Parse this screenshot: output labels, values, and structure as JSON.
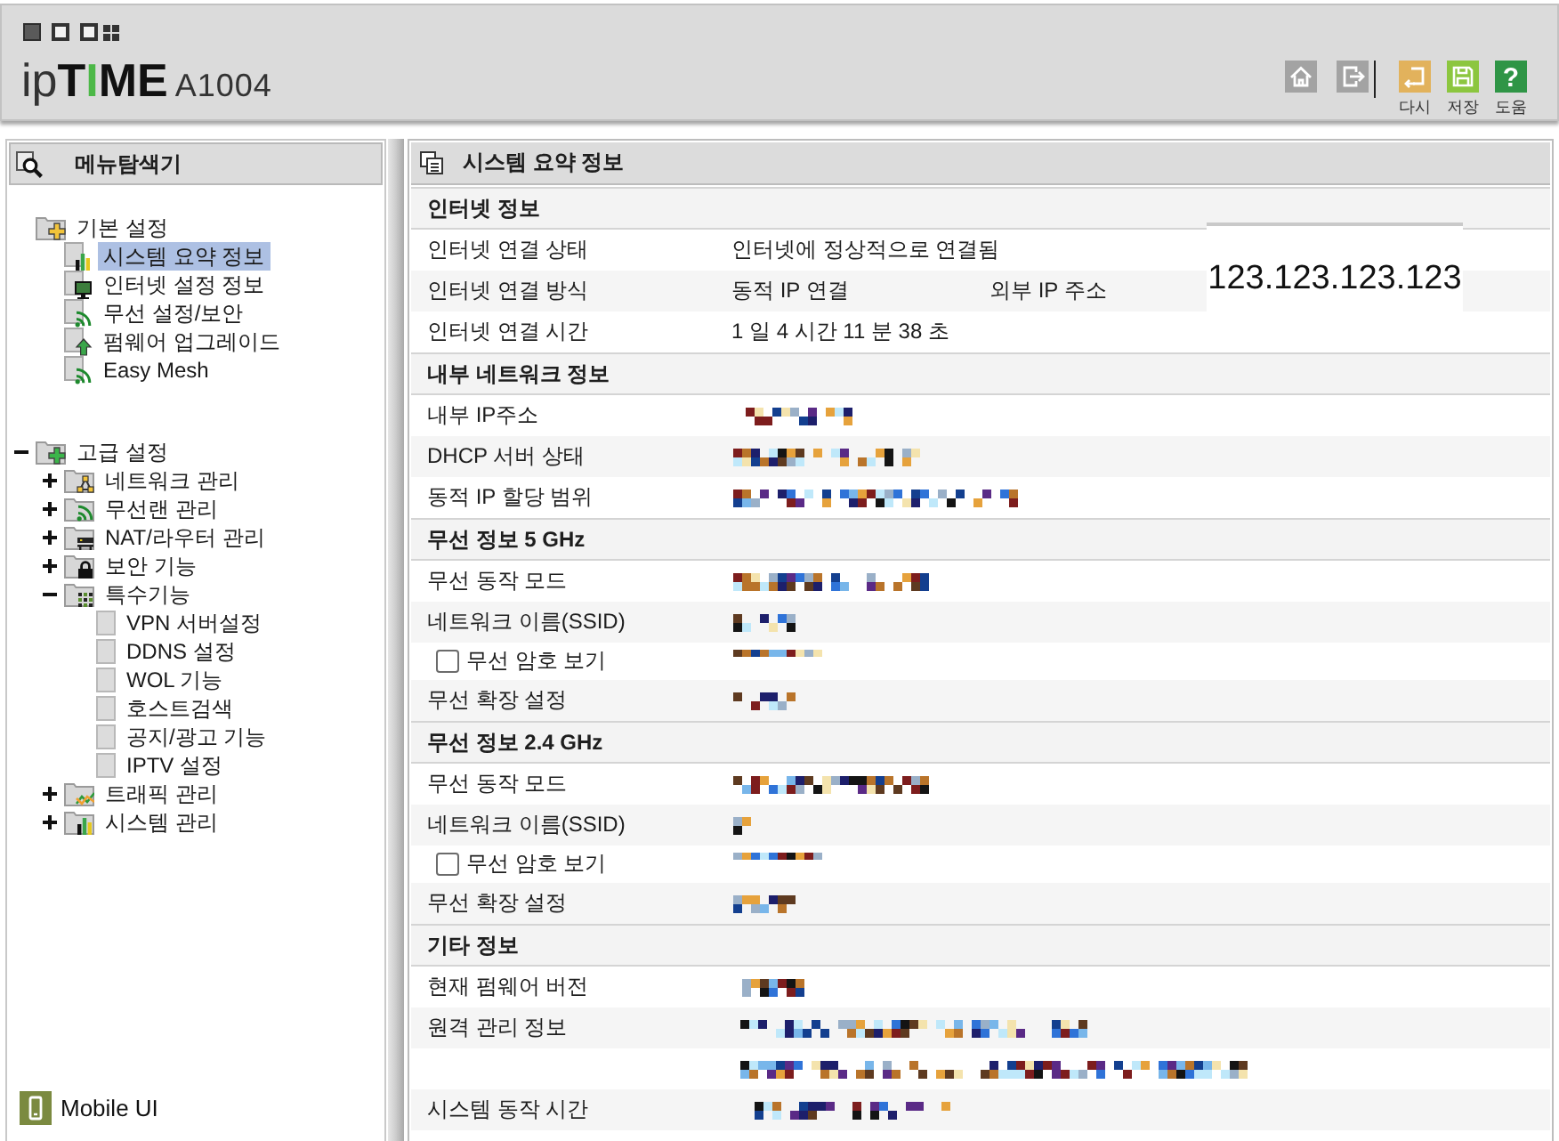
{
  "header": {
    "logo": {
      "segments": [
        {
          "text": "ip",
          "kind": "light"
        },
        {
          "text": "T",
          "kind": "bold"
        },
        {
          "text": "I",
          "kind": "accent"
        },
        {
          "text": "ME",
          "kind": "bold"
        }
      ],
      "model": "A1004"
    },
    "actions": [
      {
        "kind": "home"
      },
      {
        "kind": "logout"
      },
      {
        "kind": "retry",
        "label": "다시"
      },
      {
        "kind": "save",
        "label": "저장"
      },
      {
        "kind": "help",
        "label": "도움",
        "glyph": "?"
      }
    ]
  },
  "sidebar": {
    "title": "메뉴탐색기",
    "tree": [
      {
        "label": "기본 설정",
        "selected": false,
        "children": [
          {
            "label": "시스템 요약 정보",
            "selected": true
          },
          {
            "label": "인터넷 설정 정보",
            "selected": false
          },
          {
            "label": "무선 설정/보안",
            "selected": false
          },
          {
            "label": "펌웨어 업그레이드",
            "selected": false
          },
          {
            "label": "Easy Mesh",
            "selected": false
          }
        ]
      },
      {
        "label": "고급 설정",
        "selected": false,
        "expanded": true,
        "children": [
          {
            "label": "네트워크 관리",
            "selected": false,
            "expanded": false
          },
          {
            "label": "무선랜 관리",
            "selected": false,
            "expanded": false
          },
          {
            "label": "NAT/라우터 관리",
            "selected": false,
            "expanded": false
          },
          {
            "label": "보안 기능",
            "selected": false,
            "expanded": false
          },
          {
            "label": "특수기능",
            "selected": false,
            "expanded": true,
            "children": [
              {
                "label": "VPN 서버설정",
                "selected": false
              },
              {
                "label": "DDNS 설정",
                "selected": false
              },
              {
                "label": "WOL 기능",
                "selected": false
              },
              {
                "label": "호스트검색",
                "selected": false
              },
              {
                "label": "공지/광고 기능",
                "selected": false
              },
              {
                "label": "IPTV 설정",
                "selected": false
              }
            ]
          },
          {
            "label": "트래픽 관리",
            "selected": false,
            "expanded": false
          },
          {
            "label": "시스템 관리",
            "selected": false,
            "expanded": false
          }
        ]
      }
    ],
    "footer_link": "Mobile UI"
  },
  "main": {
    "title": "시스템 요약 정보",
    "sections": [
      {
        "title": "인터넷 정보",
        "rows": [
          {
            "kind": "text",
            "label": "인터넷 연결 상태",
            "value": "인터넷에 정상적으로 연결됨"
          },
          {
            "kind": "text",
            "label": "인터넷 연결 방식",
            "value": "동적 IP 연결",
            "extra_label": "외부 IP 주소",
            "extra_value": "123.123.123.123"
          },
          {
            "kind": "text",
            "label": "인터넷 연결 시간",
            "value": "1 일 4 시간 11 분 38 초"
          }
        ]
      },
      {
        "title": "내부 네트워크 정보",
        "rows": [
          {
            "kind": "text",
            "label": "내부 IP주소",
            "masked": true
          },
          {
            "kind": "text",
            "label": "DHCP 서버 상태",
            "masked": true
          },
          {
            "kind": "text",
            "label": "동적 IP 할당 범위",
            "masked": true
          }
        ]
      },
      {
        "title": "무선 정보 5 GHz",
        "rows": [
          {
            "kind": "text",
            "label": "무선 동작 모드",
            "masked": true
          },
          {
            "kind": "text",
            "label": "네트워크 이름(SSID)",
            "masked": true
          },
          {
            "kind": "checkbox",
            "label": "무선 암호 보기",
            "checked": false,
            "masked": true
          },
          {
            "kind": "text",
            "label": "무선 확장 설정",
            "masked": true
          }
        ]
      },
      {
        "title": "무선 정보 2.4 GHz",
        "rows": [
          {
            "kind": "text",
            "label": "무선 동작 모드",
            "masked": true
          },
          {
            "kind": "text",
            "label": "네트워크 이름(SSID)",
            "masked": true
          },
          {
            "kind": "checkbox",
            "label": "무선 암호 보기",
            "checked": false,
            "masked": true
          },
          {
            "kind": "text",
            "label": "무선 확장 설정",
            "masked": true
          }
        ]
      },
      {
        "title": "기타 정보",
        "rows": [
          {
            "kind": "text",
            "label": "현재 펌웨어 버전",
            "masked": true
          },
          {
            "kind": "text",
            "label": "원격 관리 정보",
            "masked": true
          },
          {
            "kind": "text",
            "masked": true
          },
          {
            "kind": "text",
            "label": "시스템 동작 시간",
            "masked": true
          }
        ]
      }
    ]
  }
}
